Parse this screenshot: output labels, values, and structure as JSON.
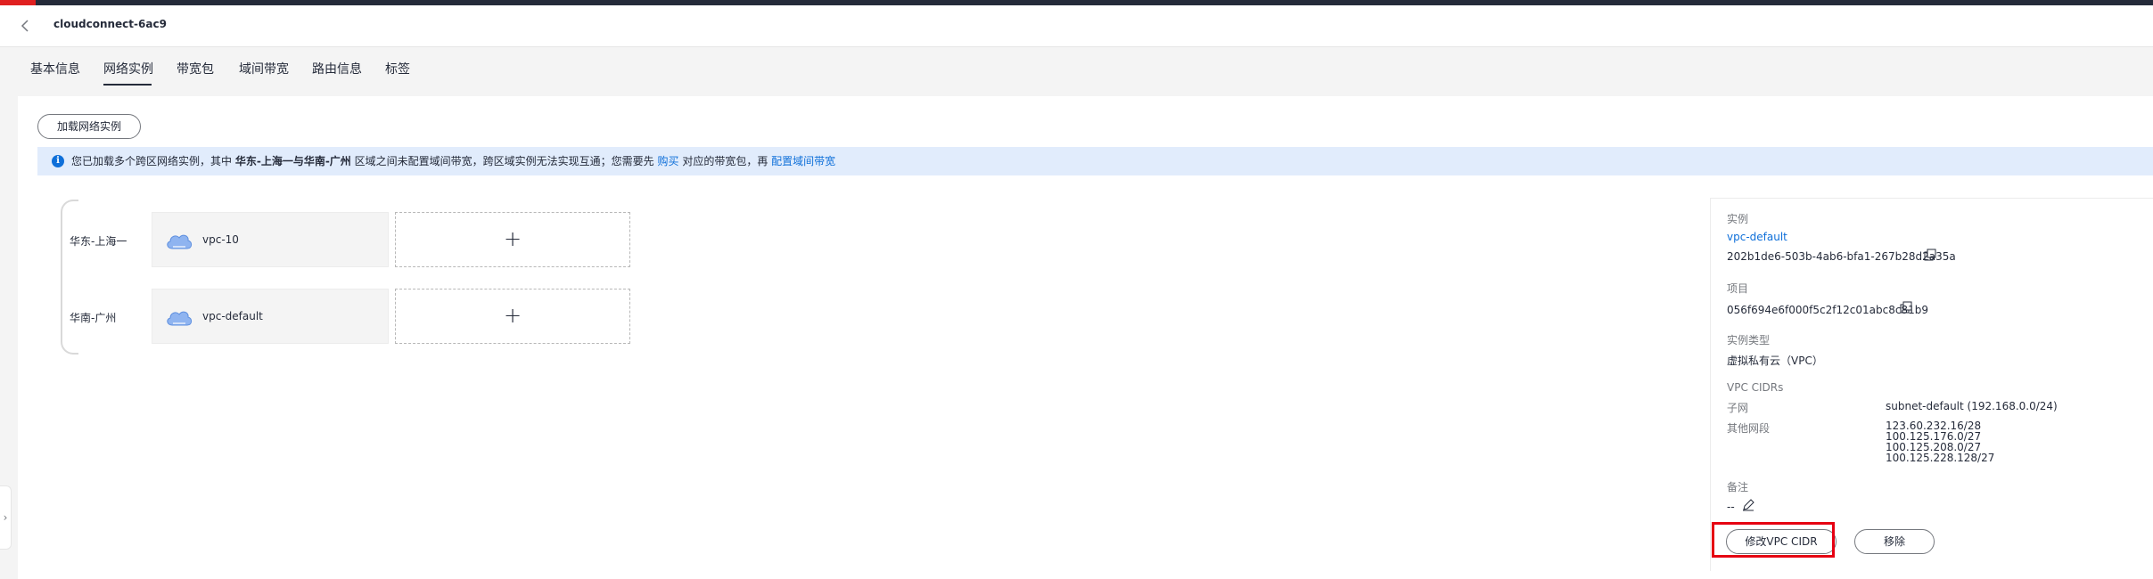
{
  "header": {
    "title": "cloudconnect-6ac9",
    "back_icon": "chevron-left-icon"
  },
  "tabs": [
    {
      "label": "基本信息",
      "active": false
    },
    {
      "label": "网络实例",
      "active": true
    },
    {
      "label": "带宽包",
      "active": false
    },
    {
      "label": "域间带宽",
      "active": false
    },
    {
      "label": "路由信息",
      "active": false
    },
    {
      "label": "标签",
      "active": false
    }
  ],
  "toolbar": {
    "load_label": "加载网络实例"
  },
  "info": {
    "icon": "info-icon",
    "prefix": "您已加载多个跨区网络实例，其中",
    "regions": "华东-上海一与华南-广州",
    "middle": "区域之间未配置域间带宽，跨区域实例无法实现互通；您需要先",
    "link_buy": "购买",
    "after_buy": "对应的带宽包，再",
    "link_config": "配置域间带宽"
  },
  "regions": [
    {
      "label": "华东-上海一",
      "vpc": "vpc-10",
      "icon": "cloud-icon",
      "add": "+"
    },
    {
      "label": "华南-广州",
      "vpc": "vpc-default",
      "icon": "cloud-icon",
      "add": "+"
    }
  ],
  "detail": {
    "instance_label": "实例",
    "instance_name": "vpc-default",
    "instance_id": "202b1de6-503b-4ab6-bfa1-267b28d2a35a",
    "project_label": "项目",
    "project_id": "056f694e6f000f5c2f12c01abc8c81b9",
    "type_label": "实例类型",
    "type_value": "虚拟私有云（VPC）",
    "cidrs_label": "VPC CIDRs",
    "subnet_label": "子网",
    "subnet_value": "subnet-default (192.168.0.0/24)",
    "other_label": "其他网段",
    "other_values": [
      "123.60.232.16/28",
      "100.125.176.0/27",
      "100.125.208.0/27",
      "100.125.228.128/27"
    ],
    "remark_label": "备注",
    "remark_value": "--",
    "modify_label": "修改VPC CIDR",
    "remove_label": "移除"
  },
  "colors": {
    "accent": "#0e6fd9",
    "highlight": "#e60012",
    "info_bg": "#e1ecfc"
  }
}
